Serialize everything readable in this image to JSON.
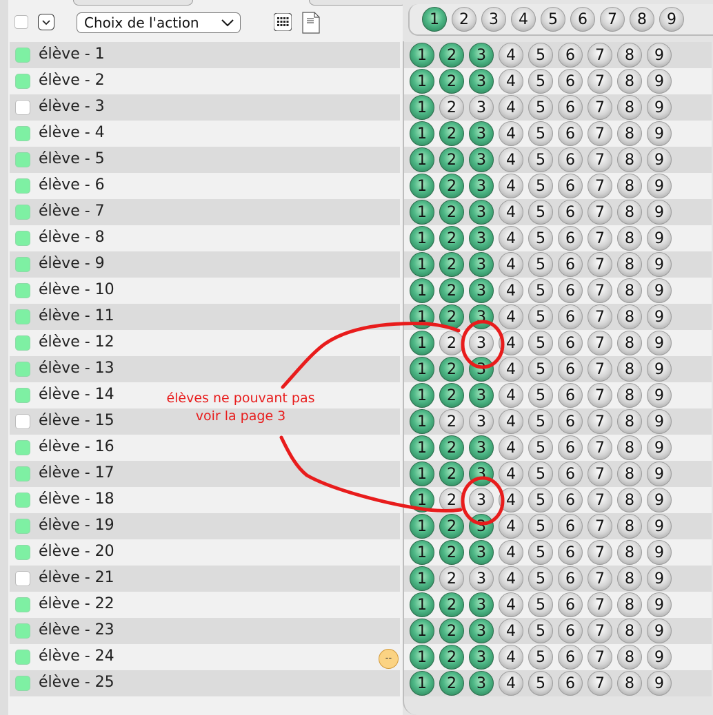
{
  "toolbar": {
    "action_select_value": "Choix de l'action"
  },
  "header_pages": [
    {
      "label": "1",
      "state": "green"
    },
    {
      "label": "2",
      "state": "silver"
    },
    {
      "label": "3",
      "state": "silver"
    },
    {
      "label": "4",
      "state": "silver"
    },
    {
      "label": "5",
      "state": "silver"
    },
    {
      "label": "6",
      "state": "silver"
    },
    {
      "label": "7",
      "state": "silver"
    },
    {
      "label": "8",
      "state": "silver"
    },
    {
      "label": "9",
      "state": "silver"
    }
  ],
  "page_labels": [
    "1",
    "2",
    "3",
    "4",
    "5",
    "6",
    "7",
    "8",
    "9"
  ],
  "students": [
    {
      "label": "élève - 1",
      "checked": true,
      "pages": [
        1,
        1,
        1,
        0,
        0,
        0,
        0,
        0,
        0
      ]
    },
    {
      "label": "élève - 2",
      "checked": true,
      "pages": [
        1,
        1,
        1,
        0,
        0,
        0,
        0,
        0,
        0
      ]
    },
    {
      "label": "élève - 3",
      "checked": false,
      "pages": [
        1,
        0,
        0,
        0,
        0,
        0,
        0,
        0,
        0
      ]
    },
    {
      "label": "élève - 4",
      "checked": true,
      "pages": [
        1,
        1,
        1,
        0,
        0,
        0,
        0,
        0,
        0
      ]
    },
    {
      "label": "élève - 5",
      "checked": true,
      "pages": [
        1,
        1,
        1,
        0,
        0,
        0,
        0,
        0,
        0
      ]
    },
    {
      "label": "élève - 6",
      "checked": true,
      "pages": [
        1,
        1,
        1,
        0,
        0,
        0,
        0,
        0,
        0
      ]
    },
    {
      "label": "élève - 7",
      "checked": true,
      "pages": [
        1,
        1,
        1,
        0,
        0,
        0,
        0,
        0,
        0
      ]
    },
    {
      "label": "élève - 8",
      "checked": true,
      "pages": [
        1,
        1,
        1,
        0,
        0,
        0,
        0,
        0,
        0
      ]
    },
    {
      "label": "élève - 9",
      "checked": true,
      "pages": [
        1,
        1,
        1,
        0,
        0,
        0,
        0,
        0,
        0
      ]
    },
    {
      "label": "élève - 10",
      "checked": true,
      "pages": [
        1,
        1,
        1,
        0,
        0,
        0,
        0,
        0,
        0
      ]
    },
    {
      "label": "élève - 11",
      "checked": true,
      "pages": [
        1,
        1,
        1,
        0,
        0,
        0,
        0,
        0,
        0
      ]
    },
    {
      "label": "élève - 12",
      "checked": true,
      "pages": [
        1,
        0,
        0,
        0,
        0,
        0,
        0,
        0,
        0
      ]
    },
    {
      "label": "élève - 13",
      "checked": true,
      "pages": [
        1,
        1,
        1,
        0,
        0,
        0,
        0,
        0,
        0
      ]
    },
    {
      "label": "élève - 14",
      "checked": true,
      "pages": [
        1,
        1,
        1,
        0,
        0,
        0,
        0,
        0,
        0
      ]
    },
    {
      "label": "élève - 15",
      "checked": false,
      "pages": [
        1,
        0,
        0,
        0,
        0,
        0,
        0,
        0,
        0
      ]
    },
    {
      "label": "élève - 16",
      "checked": true,
      "pages": [
        1,
        1,
        1,
        0,
        0,
        0,
        0,
        0,
        0
      ]
    },
    {
      "label": "élève - 17",
      "checked": true,
      "pages": [
        1,
        1,
        1,
        0,
        0,
        0,
        0,
        0,
        0
      ]
    },
    {
      "label": "élève - 18",
      "checked": true,
      "pages": [
        1,
        0,
        0,
        0,
        0,
        0,
        0,
        0,
        0
      ]
    },
    {
      "label": "élève - 19",
      "checked": true,
      "pages": [
        1,
        1,
        1,
        0,
        0,
        0,
        0,
        0,
        0
      ]
    },
    {
      "label": "élève - 20",
      "checked": true,
      "pages": [
        1,
        1,
        1,
        0,
        0,
        0,
        0,
        0,
        0
      ]
    },
    {
      "label": "élève - 21",
      "checked": false,
      "pages": [
        1,
        0,
        0,
        0,
        0,
        0,
        0,
        0,
        0
      ]
    },
    {
      "label": "élève - 22",
      "checked": true,
      "pages": [
        1,
        1,
        1,
        0,
        0,
        0,
        0,
        0,
        0
      ]
    },
    {
      "label": "élève - 23",
      "checked": true,
      "pages": [
        1,
        1,
        1,
        0,
        0,
        0,
        0,
        0,
        0
      ]
    },
    {
      "label": "élève - 24",
      "checked": true,
      "pages": [
        1,
        1,
        1,
        0,
        0,
        0,
        0,
        0,
        0
      ]
    },
    {
      "label": "élève - 25",
      "checked": true,
      "pages": [
        1,
        1,
        1,
        0,
        0,
        0,
        0,
        0,
        0
      ]
    }
  ],
  "status_badge": "--",
  "annotation": {
    "line1": "élèves ne pouvant pas",
    "line2": "voir la page 3",
    "color": "#e81c1c"
  },
  "colors": {
    "checkbox_on": "#7ef0a3",
    "circle_green": "#4fb887",
    "circle_silver": "#d4d4d4",
    "badge": "#fbd383"
  },
  "icons": [
    "chevron-down-icon",
    "grid-icon",
    "csv-file-icon"
  ]
}
